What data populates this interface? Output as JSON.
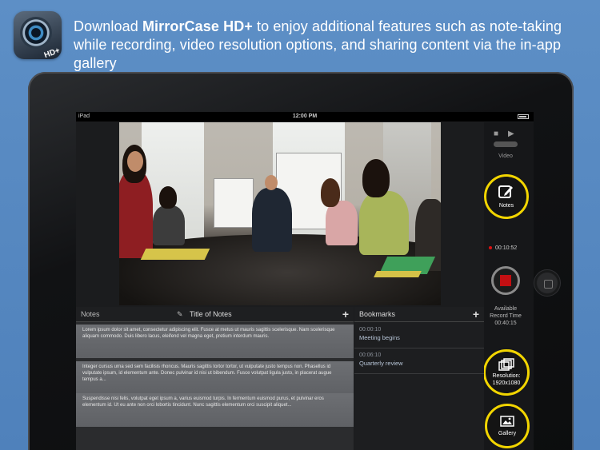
{
  "header": {
    "text_before": "Download ",
    "brand": "MirrorCase HD+",
    "text_after": " to enjoy additional features such as note-taking while recording, video resolution options, and sharing content via the in-app gallery",
    "app_icon_badge": "HD+"
  },
  "statusbar": {
    "carrier": "iPad",
    "time": "12:00 PM"
  },
  "controls": {
    "mode_label": "Video",
    "notes_button": "Notes",
    "record_elapsed": "00:10:52",
    "available_label_1": "Available",
    "available_label_2": "Record Time",
    "available_time": "00:40:15",
    "resolution_label_1": "Resolution:",
    "resolution_label_2": "1920x1080",
    "gallery_button": "Gallery"
  },
  "notes_panel": {
    "header_label": "Notes",
    "title_placeholder": "Title of Notes",
    "add_label": "+",
    "notes": [
      "Lorem ipsum dolor sit amet, consectetur adipiscing elit. Fusce at metus ut mauris sagittis scelerisque. Nam scelerisque aliquam commodo. Duis libero lacus, eleifend vel magna eget, pretium interdum mauris.",
      "Integer cursus urna sed sem facilisis rhoncus. Mauris sagittis tortor tortor, ut vulputate justo tempus non. Phasellus id vulputate ipsum, id elementum ante. Donec pulvinar id nisi ut bibendum. Fusce volutpat ligula justo, in placerat augue tempus a...",
      "Suspendisse nisi felis, volutpat eget ipsum a, varius euismod turpis. In fermentum euismod purus, et pulvinar eros elementum id. Ut eu ante non orci lobortis tincidunt. Nunc sagittis elementum orci suscipit aliquet..."
    ]
  },
  "bookmarks_panel": {
    "header_label": "Bookmarks",
    "add_label": "+",
    "items": [
      {
        "time": "00:00:10",
        "name": "Meeting begins"
      },
      {
        "time": "00:06:10",
        "name": "Quarterly review"
      }
    ]
  }
}
